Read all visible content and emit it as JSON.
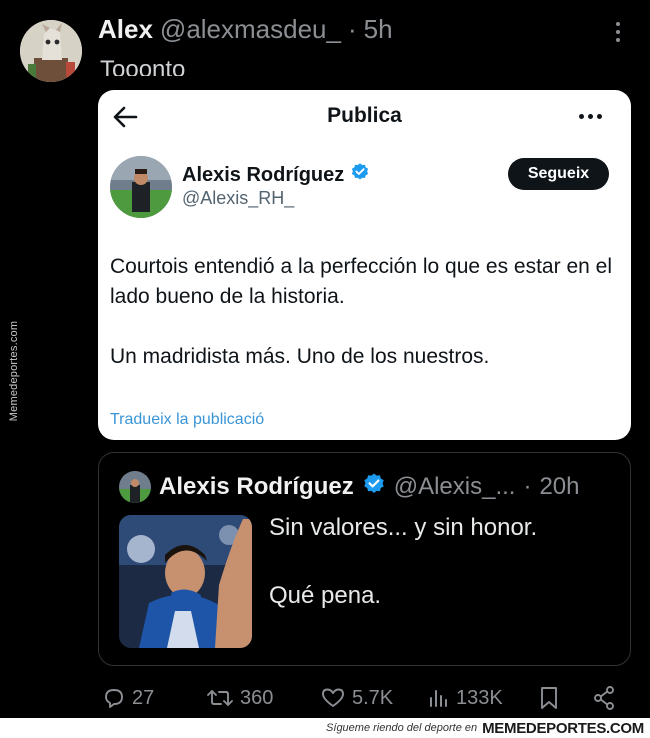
{
  "site_watermark": "Memedeportes.com",
  "tweet": {
    "author_name": "Alex",
    "author_handle": "@alexmasdeu_",
    "separator": "·",
    "time": "5h",
    "text_partial": "Tooonto"
  },
  "embedded_post": {
    "header_title": "Publica",
    "author_name": "Alexis Rodríguez",
    "author_handle": "@Alexis_RH_",
    "verified": true,
    "follow_label": "Segueix",
    "text_lines": [
      "Courtois entendió a la perfección lo que es estar en el lado bueno de la historia.",
      "Un madridista más. Uno de los nuestros."
    ],
    "translate_label": "Tradueix la publicació"
  },
  "quoted_post": {
    "author_name": "Alexis Rodríguez",
    "author_handle": "@Alexis_...",
    "separator": "·",
    "time": "20h",
    "text_lines": [
      "Sin valores... y sin honor.",
      "Qué pena."
    ]
  },
  "actions": {
    "replies": "27",
    "reposts": "360",
    "likes": "5.7K",
    "views": "133K"
  },
  "footer": {
    "tagline": "Sígueте riendo del deporte en",
    "brand": "MEMEDEPORTES.COM"
  },
  "colors": {
    "background": "#000000",
    "card_background": "#ffffff",
    "verified_blue": "#1d9bf0",
    "link_blue": "#3a95d6",
    "muted_gray": "#8b8f93"
  }
}
